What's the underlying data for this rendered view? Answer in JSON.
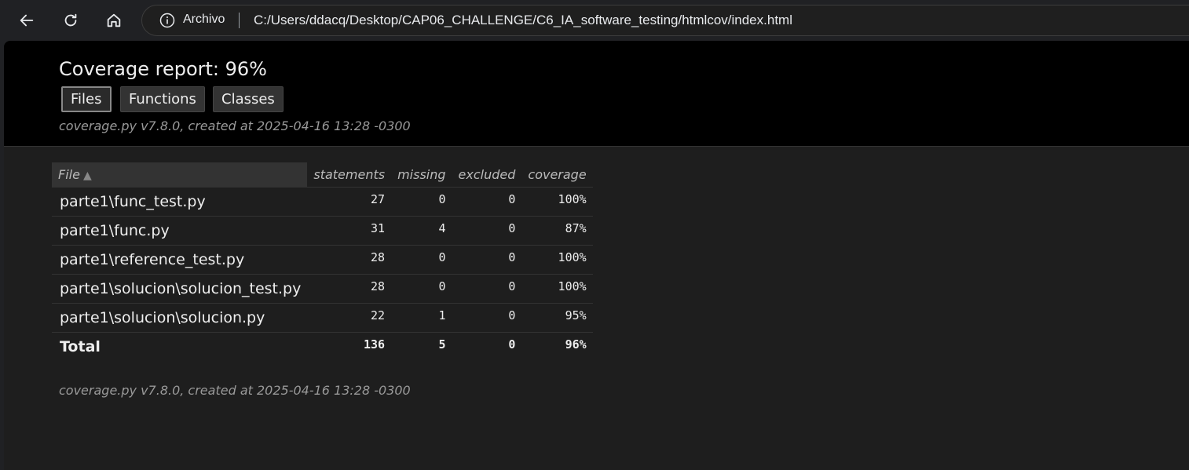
{
  "browser": {
    "scheme_label": "Archivo",
    "url": "C:/Users/ddacq/Desktop/CAP06_CHALLENGE/C6_IA_software_testing/htmlcov/index.html"
  },
  "report": {
    "title": "Coverage report: 96%",
    "tabs": [
      {
        "label": "Files",
        "current": true
      },
      {
        "label": "Functions",
        "current": false
      },
      {
        "label": "Classes",
        "current": false
      }
    ],
    "meta": "coverage.py v7.8.0, created at 2025-04-16 13:28 -0300",
    "footer_meta": "coverage.py v7.8.0, created at 2025-04-16 13:28 -0300"
  },
  "table": {
    "headers": {
      "file": "File",
      "sort_arrow": "▲",
      "statements": "statements",
      "missing": "missing",
      "excluded": "excluded",
      "coverage": "coverage"
    },
    "rows": [
      {
        "file": "parte1\\func_test.py",
        "statements": "27",
        "missing": "0",
        "excluded": "0",
        "coverage": "100%"
      },
      {
        "file": "parte1\\func.py",
        "statements": "31",
        "missing": "4",
        "excluded": "0",
        "coverage": "87%"
      },
      {
        "file": "parte1\\reference_test.py",
        "statements": "28",
        "missing": "0",
        "excluded": "0",
        "coverage": "100%"
      },
      {
        "file": "parte1\\solucion\\solucion_test.py",
        "statements": "28",
        "missing": "0",
        "excluded": "0",
        "coverage": "100%"
      },
      {
        "file": "parte1\\solucion\\solucion.py",
        "statements": "22",
        "missing": "1",
        "excluded": "0",
        "coverage": "95%"
      }
    ],
    "total": {
      "file": "Total",
      "statements": "136",
      "missing": "5",
      "excluded": "0",
      "coverage": "96%"
    }
  }
}
